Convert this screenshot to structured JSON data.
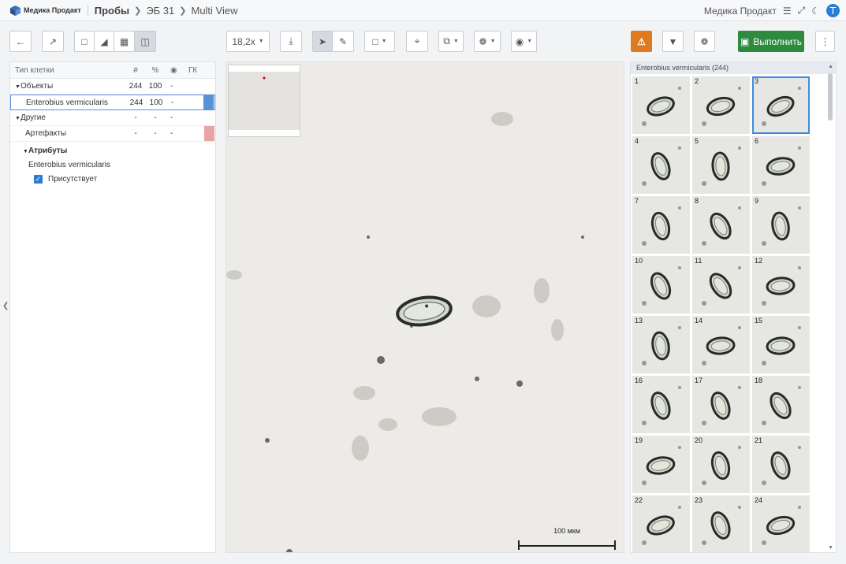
{
  "app": {
    "name": "Медика Продакт"
  },
  "breadcrumb": {
    "section": "Пробы",
    "item": "ЭБ 31",
    "view": "Multi View"
  },
  "user": {
    "org": "Медика Продакт",
    "initial": "T"
  },
  "toolbar": {
    "zoom": "18,2x",
    "run_label": "Выполнить"
  },
  "colors": {
    "accent": "#2e8b3e",
    "warn": "#e07a1f",
    "selection": "#5b8fd6",
    "artifact": "#e8a3a3"
  },
  "table": {
    "headers": {
      "type": "Тип клетки",
      "count": "#",
      "percent": "%",
      "gk": "ГК"
    },
    "rows": [
      {
        "name": "Объекты",
        "count": "244",
        "percent": "100",
        "eye": "-",
        "group": true
      },
      {
        "name": "Enterobius vermicularis",
        "count": "244",
        "percent": "100",
        "eye": "-",
        "selected": true
      },
      {
        "name": "Другие",
        "count": "-",
        "percent": "-",
        "eye": "-",
        "group": true
      },
      {
        "name": "Артефакты",
        "count": "-",
        "percent": "-",
        "eye": "-"
      }
    ]
  },
  "attributes": {
    "title": "Атрибуты",
    "class": "Enterobius vermicularis",
    "checkbox_label": "Присутствует",
    "checked": true
  },
  "viewer": {
    "scale_label": "100 мкм"
  },
  "gallery": {
    "title": "Enterobius vermicularis (244)",
    "selected": 3,
    "items": [
      "1",
      "2",
      "3",
      "4",
      "5",
      "6",
      "7",
      "8",
      "9",
      "10",
      "11",
      "12",
      "13",
      "14",
      "15",
      "16",
      "17",
      "18",
      "19",
      "20",
      "21",
      "22",
      "23",
      "24"
    ]
  }
}
